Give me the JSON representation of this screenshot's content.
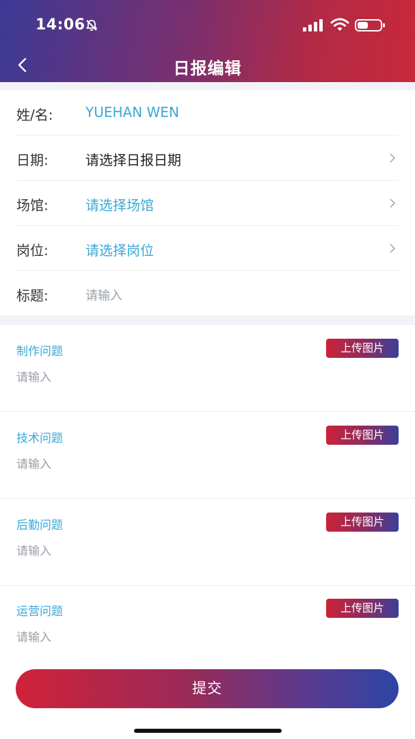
{
  "status_bar": {
    "time": "14:06"
  },
  "header": {
    "title": "日报编辑"
  },
  "form": {
    "name_label": "姓/名:",
    "name_value": "YUEHAN WEN",
    "date_label": "日期:",
    "date_value": "请选择日报日期",
    "venue_label": "场馆:",
    "venue_value": "请选择场馆",
    "position_label": "岗位:",
    "position_value": "请选择岗位",
    "title_label": "标题:",
    "title_placeholder": "请输入"
  },
  "sections": [
    {
      "title": "制作问题",
      "placeholder": "请输入",
      "upload_label": "上传图片"
    },
    {
      "title": "技术问题",
      "placeholder": "请输入",
      "upload_label": "上传图片"
    },
    {
      "title": "后勤问题",
      "placeholder": "请输入",
      "upload_label": "上传图片"
    },
    {
      "title": "运营问题",
      "placeholder": "请输入",
      "upload_label": "上传图片"
    }
  ],
  "submit_label": "提交",
  "colors": {
    "accent_blue": "#3aa8d8",
    "brand_red": "#c8283a",
    "brand_indigo": "#3c3a96"
  }
}
